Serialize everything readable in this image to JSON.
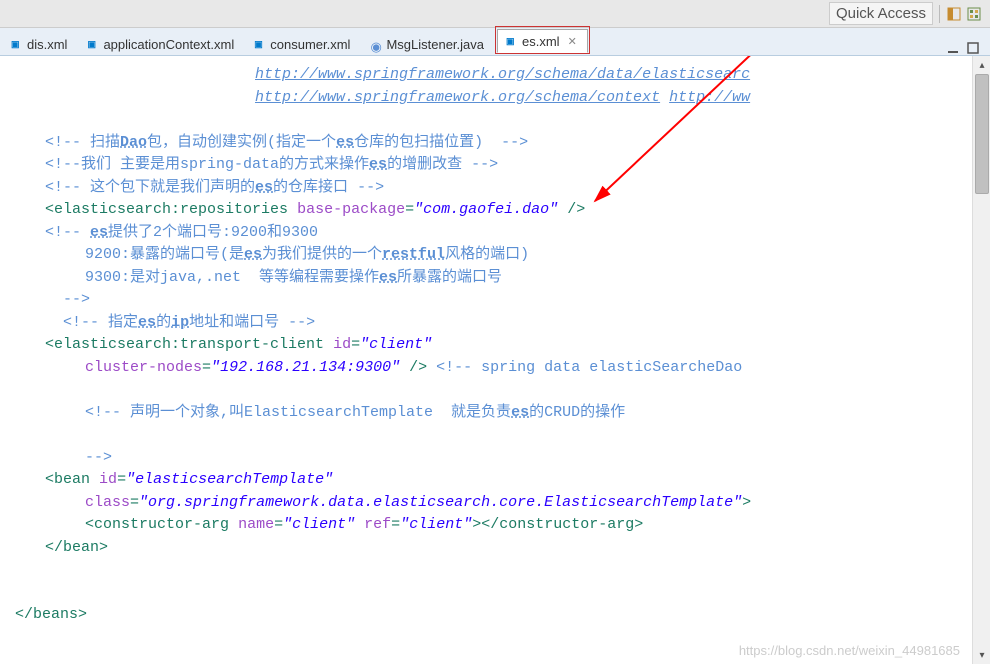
{
  "toolbar": {
    "quick_access": "Quick Access"
  },
  "tabs": [
    {
      "label": "dis.xml",
      "icon": "xml"
    },
    {
      "label": "applicationContext.xml",
      "icon": "xml"
    },
    {
      "label": "consumer.xml",
      "icon": "xml"
    },
    {
      "label": "MsgListener.java",
      "icon": "java"
    },
    {
      "label": "es.xml",
      "icon": "xml",
      "active": true
    }
  ],
  "code": {
    "url1": "http://www.springframework.org/schema/data/elasticsearc",
    "url2": "http://www.springframework.org/schema/context",
    "url2b": "http://ww",
    "c1_open": "<!--",
    "c1_text": " 扫描",
    "c1_kw1": "Dao",
    "c1_text2": "包，自动创建实例(指定一个",
    "c1_kw2": "es",
    "c1_text3": "仓库的包扫描位置)",
    "c1_close": "  -->",
    "c2_open": "<!--",
    "c2_text": "我们 主要是用spring-data的方式来操作",
    "c2_kw": "es",
    "c2_text2": "的增删改查 ",
    "c2_close": "-->",
    "c3_open": "<!--",
    "c3_text": " 这个包下就是我们声明的",
    "c3_kw": "es",
    "c3_text2": "的仓库接口 ",
    "c3_close": "-->",
    "tag1_name": "elasticsearch:repositories",
    "tag1_attr": "base-package",
    "tag1_val": "com.gaofei.dao",
    "c4_open": "<!--",
    "c4_kw": "es",
    "c4_text": "提供了2个端口号:9200和9300",
    "c4_line2a": "9200:暴露的端口号(是",
    "c4_line2kw": "es",
    "c4_line2b": "为我们提供的一个",
    "c4_line2kw2": "restful",
    "c4_line2c": "风格的端口)",
    "c4_line3a": "9300:是对java,.net  等等编程需要操作",
    "c4_line3kw": "es",
    "c4_line3b": "所暴露的端口号",
    "c4_close": "-->",
    "c5_open": "<!--",
    "c5_text": " 指定",
    "c5_kw": "es",
    "c5_text2": "的",
    "c5_kw2": "ip",
    "c5_text3": "地址和端口号 ",
    "c5_close": "-->",
    "tag2_name": "elasticsearch:transport-client",
    "tag2_attr1": "id",
    "tag2_val1": "client",
    "tag2_attr2": "cluster-nodes",
    "tag2_val2": "192.168.21.134:9300",
    "tag2_tail_open": "<!--",
    "tag2_tail": " spring data elasticSearcheDao ",
    "c6_open": "<!--",
    "c6_text": " 声明一个对象,叫ElasticsearchTemplate  就是负责",
    "c6_kw": "es",
    "c6_text2": "的CRUD的操作",
    "c6_close": "-->",
    "tag3_name": "bean",
    "tag3_attr1": "id",
    "tag3_val1": "elasticsearchTemplate",
    "tag3_attr2": "class",
    "tag3_val2": "org.springframework.data.elasticsearch.core.ElasticsearchTemplate",
    "tag4_name": "constructor-arg",
    "tag4_attr1": "name",
    "tag4_val1": "client",
    "tag4_attr2": "ref",
    "tag4_val2": "client",
    "tag5_name": "beans"
  },
  "watermark": "https://blog.csdn.net/weixin_44981685"
}
